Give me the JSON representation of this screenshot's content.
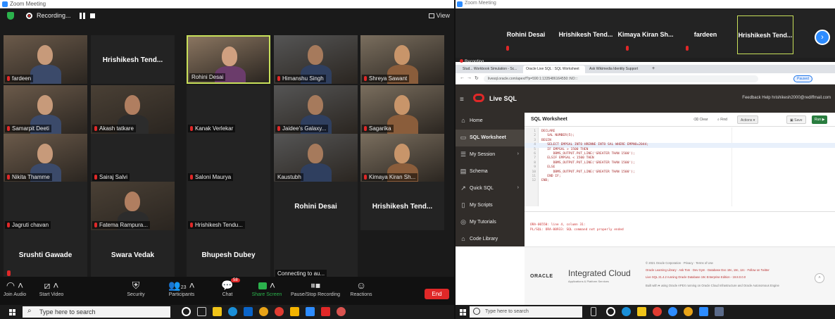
{
  "zoom_left": {
    "window_title": "Zoom Meeting",
    "recording_text": "Recording...",
    "view_label": "View",
    "tiles": [
      {
        "id": "fardeen",
        "label": "fardeen",
        "video": true,
        "muted": true
      },
      {
        "id": "hrishikesh1",
        "center_name": "Hrishikesh Tend...",
        "video": false,
        "muted": false
      },
      {
        "id": "rohini",
        "label": "Rohini Desai",
        "video": true,
        "muted": false,
        "speaking": true
      },
      {
        "id": "himanshu",
        "label": "Himanshu Singh",
        "video": true,
        "muted": true
      },
      {
        "id": "shreya",
        "label": "Shreya Sawant",
        "video": true,
        "muted": true
      },
      {
        "id": "samarpit",
        "label": "Samarpit Deeti",
        "video": true,
        "muted": true
      },
      {
        "id": "akash",
        "label": "Akash tatkare",
        "video": true,
        "muted": true
      },
      {
        "id": "kanak",
        "label": "Kanak Verlekar",
        "video": false,
        "muted": true
      },
      {
        "id": "jaidee",
        "label": "Jaidee's Galaxy...",
        "video": true,
        "muted": true
      },
      {
        "id": "sagarika",
        "label": "Sagarika",
        "video": true,
        "muted": true
      },
      {
        "id": "nikita",
        "label": "Nikita Thamme",
        "video": true,
        "muted": true
      },
      {
        "id": "sairaj",
        "label": "Sairaj Salvi",
        "video": false,
        "muted": true
      },
      {
        "id": "saloni",
        "label": "Saloni Maurya",
        "video": false,
        "muted": true
      },
      {
        "id": "kaustubh",
        "label": "Kaustubh",
        "video": true,
        "muted": false
      },
      {
        "id": "kimaya",
        "label": "Kimaya Kiran Sh...",
        "video": true,
        "muted": true
      },
      {
        "id": "jagruti",
        "label": "Jagruti chavan",
        "video": false,
        "muted": true
      },
      {
        "id": "fatema",
        "label": "Fatema Rampura...",
        "video": true,
        "muted": true
      },
      {
        "id": "hrishikesh2",
        "label": "Hrishikesh Tendu...",
        "video": false,
        "muted": true
      },
      {
        "id": "rohini2",
        "center_name": "Rohini Desai",
        "video": false,
        "muted": false
      },
      {
        "id": "hrishikesh3",
        "center_name": "Hrishikesh Tend...",
        "video": false,
        "muted": false
      },
      {
        "id": "srushti",
        "center_name": "Srushti Gawade",
        "video": false,
        "muted": true
      },
      {
        "id": "swara",
        "center_name": "Swara Vedak",
        "video": false,
        "muted": false
      },
      {
        "id": "bhupesh",
        "center_name": "Bhupesh Dubey",
        "video": false,
        "muted": false
      },
      {
        "id": "connecting",
        "label": "Connecting to au...",
        "video": false,
        "muted": false
      }
    ],
    "toolbar": {
      "join_audio": "Join Audio",
      "start_video": "Start Video",
      "security": "Security",
      "participants": "Participants",
      "participants_count": "23",
      "chat": "Chat",
      "chat_badge": "58",
      "share_screen": "Share Screen",
      "pause_stop_recording": "Pause/Stop Recording",
      "reactions": "Reactions",
      "end": "End"
    },
    "taskbar": {
      "search_placeholder": "Type here to search"
    }
  },
  "zoom_right": {
    "window_title": "Zoom Meeting",
    "strip_tiles": [
      "Rohini Desai",
      "Hrishikesh Tend...",
      "Kimaya Kiran Sh...",
      "fardeen",
      "Hrishikesh Tend..."
    ],
    "recording_label": "Recording",
    "browser": {
      "tabs": [
        "Stud... Workbook Simulation - Sc...",
        "Oracle Live SQL : SQL Worksheet",
        "Ask Wikimedia Identity Support"
      ],
      "address": "livesql.oracle.com/apex/f?p=590:1:1335486164550::NO:::",
      "paused": "Paused"
    },
    "livesql": {
      "brand": "Live SQL",
      "header_links": "Feedback   Help   hrishikesh2000@rediffmail.com",
      "sidebar": [
        "Home",
        "SQL Worksheet",
        "My Session",
        "Schema",
        "Quick SQL",
        "My Scripts",
        "My Tutorials",
        "Code Library"
      ],
      "worksheet_title": "SQL Worksheet",
      "actions": {
        "clear": "Clear",
        "find": "Find",
        "actions": "Actions",
        "save": "Save",
        "run": "Run"
      },
      "code_lines": [
        "DECLARE",
        "   SAL NUMBER(5);",
        "BEGIN",
        "   SELECT EMPSAL INTO HRENNE INTO SAL WHERE EMPNO=2044;",
        "   IF EMPSAL > 1500 THEN",
        "      DBMS_OUTPUT.PUT_LINE('GREATER THAN 1500');",
        "   ELSIF EMPSAL < 1500 THEN",
        "      DBMS_OUTPUT.PUT_LINE('GREATER THAN 1500');",
        "   ELSE",
        "      DBMS_OUTPUT.PUT_LINE('GREATER THAN 1500');",
        "   END IF;",
        "END;"
      ],
      "errors": [
        "ORA-06550: line 4, column 31:",
        "PL/SQL: ORA-00933: SQL command not properly ended"
      ],
      "footer": {
        "oracle": "ORACLE",
        "integrated_cloud": "Integrated Cloud",
        "icloud_sub": "Applications & Platform Services",
        "lines": [
          "© 2021 Oracle Corporation · Privacy · Terms of Use",
          "Oracle Learning Library · Ask Tom · Dev Gym · Database Doc 19c, 18c, 12c · Follow on Twitter",
          "Live SQL 21.4.2 running Oracle Database 19c Enterprise Edition - 19.8.0.0.0",
          "Built with ♥ using Oracle APEX running on Oracle Cloud Infrastructure and Oracle Autonomous Engine"
        ]
      }
    },
    "taskbar": {
      "search_placeholder": "Type here to search"
    }
  }
}
